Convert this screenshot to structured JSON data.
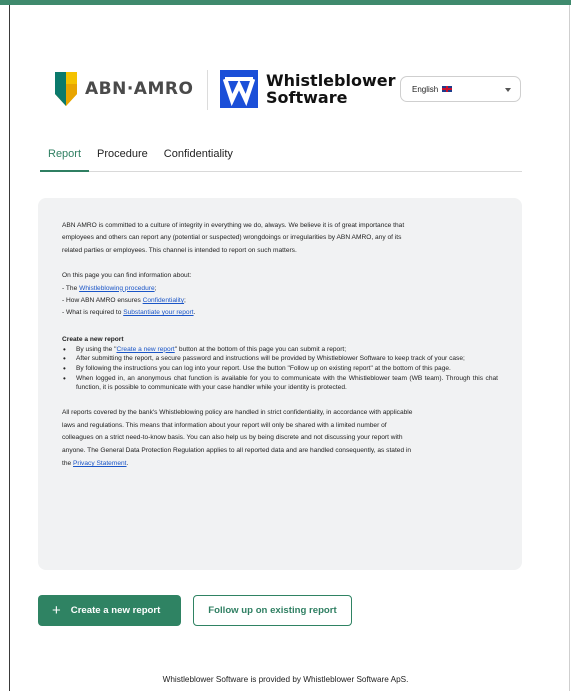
{
  "header": {
    "abn_logo_text": "ABN·AMRO",
    "wb_logo_line1": "Whistleblower",
    "wb_logo_line2": "Software",
    "language": {
      "selected": "English"
    }
  },
  "colors": {
    "accent": "#2f8363",
    "topbar": "#3f8a6d",
    "link": "#1a55c7",
    "panel": "#f1f2f3"
  },
  "tabs": [
    {
      "label": "Report",
      "active": true
    },
    {
      "label": "Procedure",
      "active": false
    },
    {
      "label": "Confidentiality",
      "active": false
    }
  ],
  "intro": {
    "line1": "ABN AMRO is committed to a culture of integrity in everything we do, always. We believe it is of great importance that",
    "line2": "employees and others can report any (potential or suspected) wrongdoings or irregularities by ABN AMRO, any of its",
    "line3": "related parties or employees. This channel is intended to report on such matters."
  },
  "info": {
    "lead": "On this page you can find information about:",
    "item1_prefix": "- The ",
    "item1_link": "Whistleblowing procedure",
    "item1_suffix": ";",
    "item2_prefix": "- How ABN AMRO ensures ",
    "item2_link": "Confidentiality",
    "item2_suffix": ";",
    "item3_prefix": "- What is required to ",
    "item3_link": "Substantiate your report",
    "item3_suffix": "."
  },
  "create_section": {
    "heading": "Create a new report",
    "b1_prefix": "By using the \"",
    "b1_link": "Create a new report",
    "b1_suffix": "\" button at the bottom of this page you can submit a report;",
    "b2": "After submitting the report, a secure password and instructions will be provided by Whistleblower Software to keep track of your case;",
    "b3": "By following the instructions you can log into your report. Use the button \"Follow up on existing report\" at the bottom of this page.",
    "b4": "When logged in, an anonymous chat function is available for you to communicate with the Whistleblower team (WB team). Through this chat function, it is possible to communicate with your case handler while your identity is protected."
  },
  "confidential": {
    "line1": "All reports covered by the bank's Whistleblowing policy are handled in strict confidentiality, in accordance with applicable",
    "line2": "laws and regulations. This means that information about your report will only be shared with a limited number of",
    "line3": "colleagues on a strict need-to-know basis. You can also help us by being discrete and not discussing your report with",
    "line4": "anyone. The General Data Protection Regulation applies to all reported data and are handled consequently, as stated in",
    "line5_prefix": "the ",
    "line5_link": "Privacy Statement",
    "line5_suffix": "."
  },
  "buttons": {
    "create_label": "Create a new report",
    "follow_label": "Follow up on existing report"
  },
  "footer": {
    "text": "Whistleblower Software is provided by Whistleblower Software ApS."
  }
}
